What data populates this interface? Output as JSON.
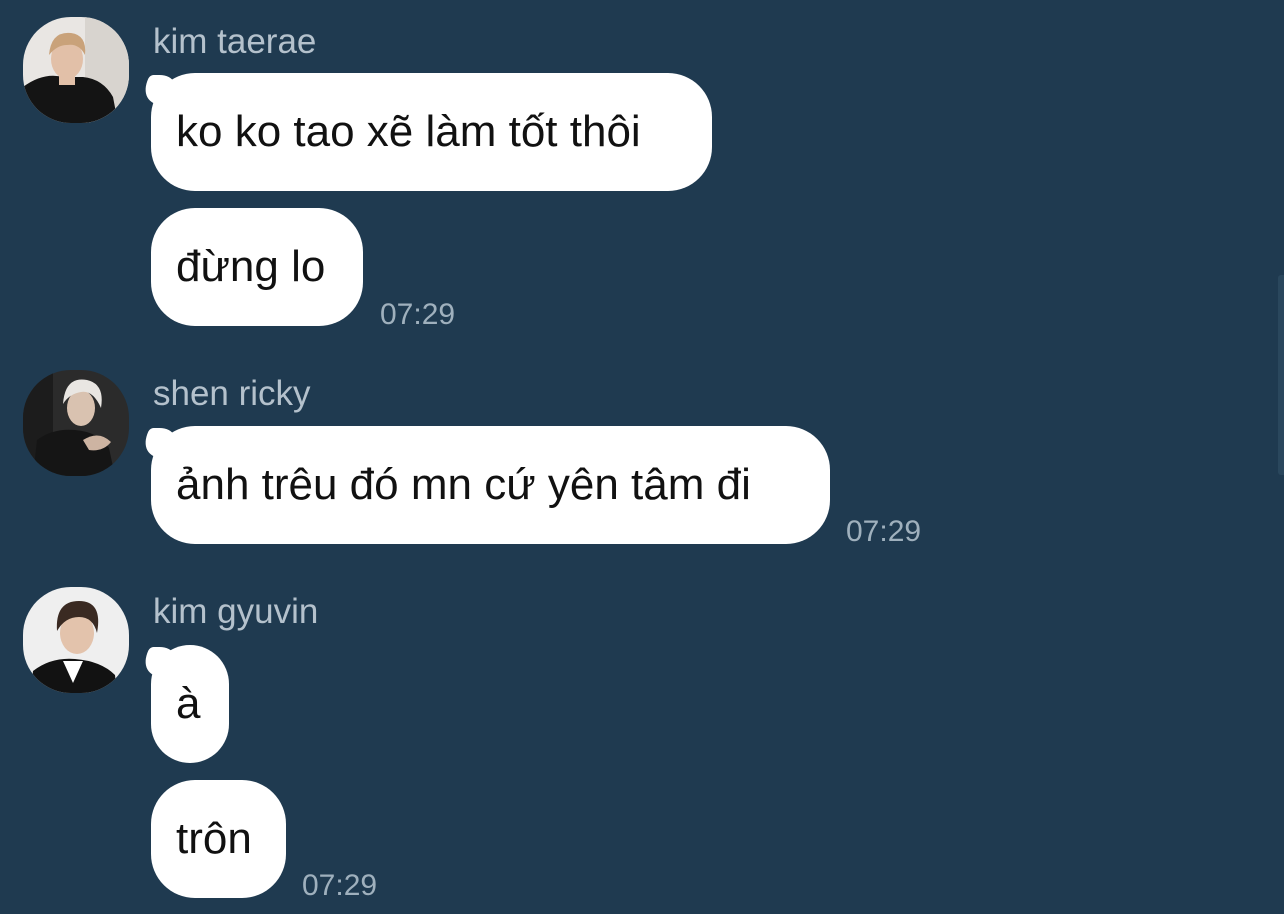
{
  "colors": {
    "background": "#1f3a50",
    "bubble": "#ffffff",
    "sender_name": "#b4c1cc",
    "timestamp": "#9fb0bd"
  },
  "messages": [
    {
      "sender": "kim taerae",
      "avatar_icon": "avatar-photo",
      "lines": [
        "ko ko tao xẽ làm tốt thôi",
        "đừng lo"
      ],
      "time": "07:29"
    },
    {
      "sender": "shen ricky",
      "avatar_icon": "avatar-photo",
      "lines": [
        "ảnh trêu đó mn cứ yên tâm đi"
      ],
      "time": "07:29"
    },
    {
      "sender": "kim gyuvin",
      "avatar_icon": "avatar-photo",
      "lines": [
        "à",
        "trôn"
      ],
      "time": "07:29"
    }
  ]
}
